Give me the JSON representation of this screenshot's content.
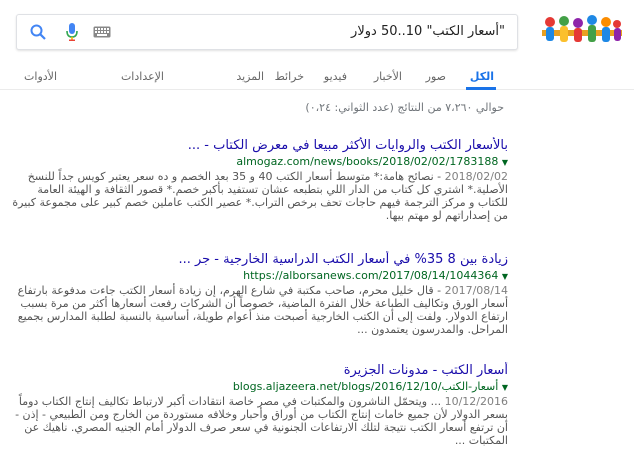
{
  "search": {
    "query": "\"أسعار الكتب\" 10..50 دولار"
  },
  "tabs": [
    {
      "label": "الكل",
      "active": true
    },
    {
      "label": "صور"
    },
    {
      "label": "الأخبار"
    },
    {
      "label": "فيديو"
    },
    {
      "label": "خرائط"
    },
    {
      "label": "المزيد"
    },
    {
      "label": "الإعدادات"
    },
    {
      "label": "الأدوات"
    }
  ],
  "stats": "حوالي ٧،٢٦٠ من النتائج (عدد الثواني: ٠،٢٤)",
  "results": [
    {
      "title": "بالأسعار الكتب والروايات الأكثر مبيعا في معرض الكتاب - ...",
      "url": "almogaz.com/news/books/2018/02/02/1783188",
      "date": "2018/02/02",
      "snippet": " - نصائح هامة:* متوسط أسعار الكتب 40 و 35 بعد الخصم و ده سعر يعتبر كويس جداً للنسخ الأصلية.* اشتري كل كتاب من الدار اللي بتطبعه عشان تستفيد بأكبر خصم.* قصور الثقافة و الهيئة العامة للكتاب و مركز الترجمة فيهم حاجات تحف برخص التراب.* عصير الكتب عاملين خصم كبير على مجموعة كبيرة من إصداراتهم لو مهتم بيها."
    },
    {
      "title": "زيادة بين 8 35% في أسعار الكتب الدراسية الخارجية - جر ...",
      "url": "https://alborsanews.com/2017/08/14/1044364",
      "date": "2017/08/14",
      "snippet": " - قال خليل محرم، صاحب مكتبة في شارع الهرم، إن زيادة أسعار الكتب جاءت مدفوعة بارتفاع أسعار الورق وتكاليف الطباعة خلال الفترة الماضية، خصوصاً أن الشركات رفعت أسعارها أكثر من مرة بسبب ارتفاع الدولار. ولفت إلى أن الكتب الخارجية أصبحت منذ أعوام طويلة، أساسية بالنسبة لطلبة المدارس بجميع المراحل. والمدرسون يعتمدون ..."
    },
    {
      "title": "أسعار الكتب - مدونات الجزيرة",
      "url": "blogs.aljazeera.net/blogs/2016/12/10/أسعار-الكتب",
      "date": "10/12/2016",
      "snippet": " ... ويتحمّل الناشرون والمكتبات في مصر خاصة انتقادات أكبر لارتباط تكاليف إنتاج الكتاب دوماً بسعر الدولار لأن جميع خامات إنتاج الكتاب من أوراق وأحبار وخلافه مستوردة من الخارج ومن الطبيعي - إذن - أن ترتفع أسعار الكتب نتيجة لتلك الارتفاعات الجنونية في سعر صرف الدولار أمام الجنيه المصري. ناهيك عن المكتبات ..."
    }
  ]
}
